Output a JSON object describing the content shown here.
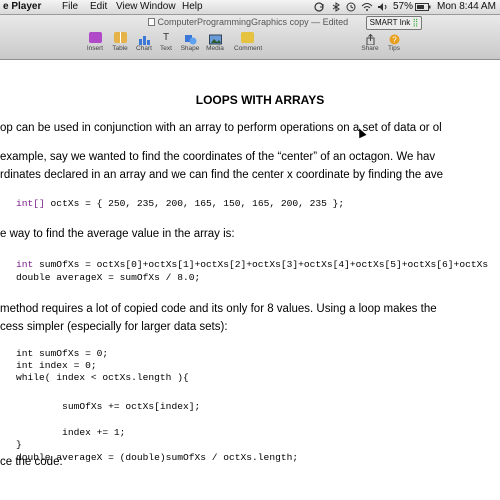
{
  "menubar": {
    "app_name": "e Player",
    "items": [
      "File",
      "Edit",
      "View",
      "Window",
      "Help"
    ],
    "battery": "57%",
    "clock": "Mon 8:44 AM"
  },
  "window": {
    "title": "ComputerProgrammingGraphics copy",
    "status": "— Edited"
  },
  "smart_ink": {
    "label": "SMART Ink"
  },
  "toolbar": {
    "insert": "Insert",
    "table": "Table",
    "chart": "Chart",
    "text": "Text",
    "shape": "Shape",
    "media": "Media",
    "comment": "Comment",
    "share": "Share",
    "tips": "Tips"
  },
  "document": {
    "heading": "LOOPS WITH ARRAYS",
    "intro": "op can be used in conjunction with an array to perform operations on a set of data or ol",
    "example_line1": "example, say we wanted to find the coordinates of the “center” of an octagon.  We hav",
    "example_line2": "rdinates declared in an array and we can find the center x coordinate by finding the ave",
    "code_array_kw": "int[]",
    "code_array_rest": " octXs = { 250, 235, 200, 165, 150, 165, 200, 235 };",
    "way_text": "e way to find the average value in the array is:",
    "code_sum_kw": "int",
    "code_sum_rest": " sumOfXs = octXs[0]+octXs[1]+octXs[2]+octXs[3]+octXs[4]+octXs[5]+octXs[6]+octXs",
    "code_avg": "double averageX = sumOfXs / 8.0;",
    "method_line1": " method requires a lot of copied code and its only for 8 values. Using a loop makes the",
    "method_line2": "cess simpler (especially for larger data sets):",
    "loop_code": [
      "int sumOfXs = 0;",
      "int index = 0;",
      "while( index < octXs.length ){",
      "",
      "        sumOfXs += octXs[index];",
      "",
      "        index += 1;",
      "}",
      "double averageX = (double)sumOfXs / octXs.length;"
    ],
    "trace_text": "ce the code:"
  },
  "colors": {
    "keyword": "#7a1f8a",
    "toolbar_bg": "#d4d4d4"
  }
}
